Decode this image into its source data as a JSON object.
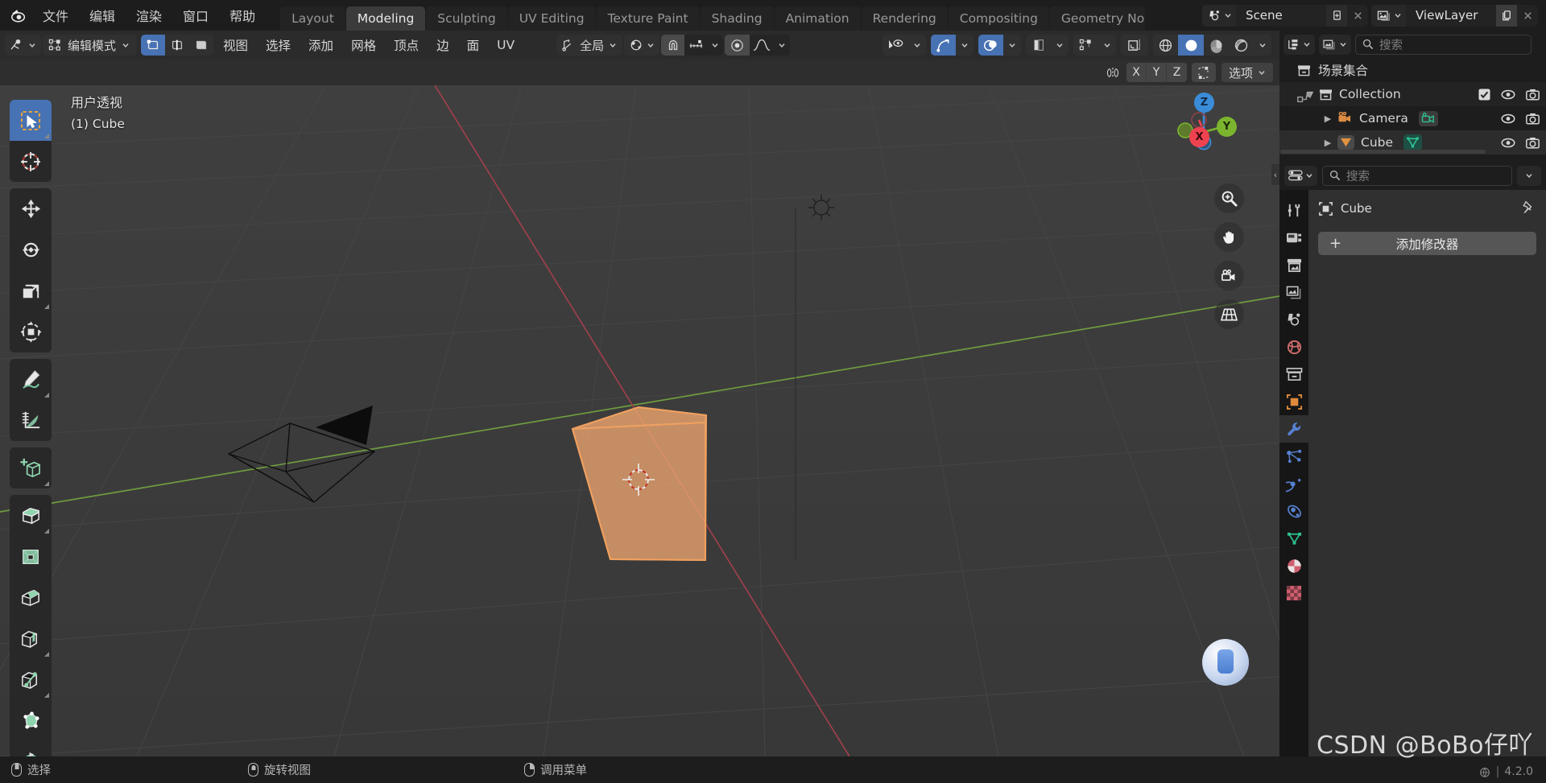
{
  "app": {
    "name": "Blender",
    "version": "4.2.0",
    "watermark": "CSDN @BoBo仔吖"
  },
  "topbar": {
    "logo_icon": "blender-logo-icon",
    "menus": [
      {
        "label": "文件",
        "name": "menu-file"
      },
      {
        "label": "编辑",
        "name": "menu-edit"
      },
      {
        "label": "渲染",
        "name": "menu-render"
      },
      {
        "label": "窗口",
        "name": "menu-window"
      },
      {
        "label": "帮助",
        "name": "menu-help"
      }
    ],
    "workspace_tabs": [
      {
        "label": "Layout",
        "active": false
      },
      {
        "label": "Modeling",
        "active": true
      },
      {
        "label": "Sculpting",
        "active": false
      },
      {
        "label": "UV Editing",
        "active": false
      },
      {
        "label": "Texture Paint",
        "active": false
      },
      {
        "label": "Shading",
        "active": false
      },
      {
        "label": "Animation",
        "active": false
      },
      {
        "label": "Rendering",
        "active": false
      },
      {
        "label": "Compositing",
        "active": false
      },
      {
        "label": "Geometry No",
        "active": false
      }
    ],
    "scene": {
      "browse_icon": "scene-browse-icon",
      "value": "Scene",
      "new_icon": "new-scene-icon",
      "delete_icon": "close-icon"
    },
    "view_layer": {
      "browse_icon": "viewlayer-browse-icon",
      "value": "ViewLayer",
      "new_icon": "copy-icon",
      "delete_icon": "close-icon"
    }
  },
  "viewport_header": {
    "editor_type_icon": "editor-type-3dview-icon",
    "mode": "编辑模式",
    "select_modes": [
      {
        "name": "vertex-select-mode",
        "active": true
      },
      {
        "name": "edge-select-mode",
        "active": false
      },
      {
        "name": "face-select-mode",
        "active": false
      }
    ],
    "menus": [
      {
        "label": "视图",
        "name": "menu-view"
      },
      {
        "label": "选择",
        "name": "menu-select"
      },
      {
        "label": "添加",
        "name": "menu-add"
      },
      {
        "label": "网格",
        "name": "menu-mesh"
      },
      {
        "label": "顶点",
        "name": "menu-vertex"
      },
      {
        "label": "边",
        "name": "menu-edge"
      },
      {
        "label": "面",
        "name": "menu-face"
      },
      {
        "label": "UV",
        "name": "menu-uv"
      }
    ],
    "transform_orientation": "全局",
    "snap_enabled": true,
    "proportional_edit_enabled": true,
    "shading_modes": [
      {
        "name": "wireframe-shading",
        "active": false
      },
      {
        "name": "solid-shading",
        "active": true
      },
      {
        "name": "material-preview-shading",
        "active": false
      },
      {
        "name": "rendered-shading",
        "active": false
      }
    ]
  },
  "viewport_subheader": {
    "mirror_icon": "mirror-icon",
    "axes": [
      "X",
      "Y",
      "Z"
    ],
    "topology_mirror_icon": "topology-mirror-icon",
    "options_label": "选项"
  },
  "viewport": {
    "view_name": "用户透视",
    "object_info": "(1) Cube",
    "gizmo": {
      "axes": [
        {
          "label": "Z",
          "color": "#3b8cd8"
        },
        {
          "label": "Y",
          "color": "#7bb52e"
        },
        {
          "label": "X",
          "color": "#ef4250"
        }
      ]
    },
    "nav_buttons": [
      {
        "name": "zoom-view-icon"
      },
      {
        "name": "pan-view-icon"
      },
      {
        "name": "camera-view-icon"
      },
      {
        "name": "toggle-perspective-icon"
      }
    ],
    "tools": [
      {
        "name": "tool-tweak-select-box",
        "active": true,
        "icon": "select-box-icon"
      },
      {
        "name": "tool-cursor",
        "active": false,
        "icon": "cursor-3d-icon"
      },
      {
        "name": "tool-move",
        "active": false,
        "icon": "move-icon"
      },
      {
        "name": "tool-rotate",
        "active": false,
        "icon": "rotate-icon"
      },
      {
        "name": "tool-scale",
        "active": false,
        "icon": "scale-icon"
      },
      {
        "name": "tool-transform",
        "active": false,
        "icon": "transform-icon"
      },
      {
        "name": "tool-annotate",
        "active": false,
        "icon": "annotate-icon"
      },
      {
        "name": "tool-measure",
        "active": false,
        "icon": "measure-icon"
      },
      {
        "name": "tool-add-cube",
        "active": false,
        "icon": "add-cube-icon"
      },
      {
        "name": "tool-extrude-region",
        "active": false,
        "icon": "extrude-region-icon"
      },
      {
        "name": "tool-inset-faces",
        "active": false,
        "icon": "inset-faces-icon"
      },
      {
        "name": "tool-bevel",
        "active": false,
        "icon": "bevel-icon"
      },
      {
        "name": "tool-loop-cut",
        "active": false,
        "icon": "loop-cut-icon"
      },
      {
        "name": "tool-knife",
        "active": false,
        "icon": "knife-icon"
      },
      {
        "name": "tool-poly-build",
        "active": false,
        "icon": "poly-build-icon"
      },
      {
        "name": "tool-spin",
        "active": false,
        "icon": "spin-icon"
      }
    ]
  },
  "outliner": {
    "display_mode_icon": "outliner-display-mode-icon",
    "filter_icon": "outliner-filter-icon",
    "search_placeholder": "搜索",
    "rows": [
      {
        "label": "场景集合",
        "name": "outliner-scene-collection",
        "indent": 0,
        "icon": "collection-icon",
        "expand": "",
        "restrict": []
      },
      {
        "label": "Collection",
        "name": "outliner-collection",
        "indent": 1,
        "icon": "collection-icon",
        "expand": "▼",
        "restrict": [
          "checkbox-checked",
          "eye-icon",
          "camera-icon"
        ]
      },
      {
        "label": "Camera",
        "name": "outliner-object-camera",
        "indent": 2,
        "icon": "camera-data-icon",
        "expand": "▶",
        "restrict": [
          "eye-icon",
          "camera-icon"
        ]
      },
      {
        "label": "Cube",
        "name": "outliner-object-cube",
        "indent": 2,
        "icon": "mesh-object-icon",
        "expand": "▶",
        "restrict": [
          "eye-icon",
          "camera-icon"
        ]
      }
    ]
  },
  "properties": {
    "editor_icon": "properties-editor-icon",
    "search_placeholder": "搜索",
    "expand_icon": "chevron-down-icon",
    "tabs": [
      {
        "name": "tab-tool",
        "icon": "tool-icon",
        "active": false,
        "color": "#c8c8c8"
      },
      {
        "name": "tab-render",
        "icon": "render-camera-icon",
        "active": false,
        "color": "#c8c8c8"
      },
      {
        "name": "tab-output",
        "icon": "printer-icon",
        "active": false,
        "color": "#c8c8c8"
      },
      {
        "name": "tab-view-layer",
        "icon": "images-icon",
        "active": false,
        "color": "#c8c8c8"
      },
      {
        "name": "tab-scene",
        "icon": "scene-cone-icon",
        "active": false,
        "color": "#c8c8c8"
      },
      {
        "name": "tab-world",
        "icon": "world-globe-icon",
        "active": false,
        "color": "#cf6b6b"
      },
      {
        "name": "tab-collection",
        "icon": "collection-box-icon",
        "active": false,
        "color": "#c8c8c8"
      },
      {
        "name": "tab-object",
        "icon": "object-square-icon",
        "active": false,
        "color": "#e08a3c"
      },
      {
        "name": "tab-modifiers",
        "icon": "wrench-icon",
        "active": true,
        "color": "#5680d0"
      },
      {
        "name": "tab-particles",
        "icon": "particles-icon",
        "active": false,
        "color": "#5680d0"
      },
      {
        "name": "tab-physics",
        "icon": "physics-orbit-icon",
        "active": false,
        "color": "#5680d0"
      },
      {
        "name": "tab-constraints",
        "icon": "constraints-icon",
        "active": false,
        "color": "#5680d0"
      },
      {
        "name": "tab-object-data",
        "icon": "mesh-data-triangle-icon",
        "active": false,
        "color": "#2fbf8f"
      },
      {
        "name": "tab-material",
        "icon": "material-sphere-icon",
        "active": false,
        "color": "#cf5f6e"
      },
      {
        "name": "tab-texture",
        "icon": "texture-checker-icon",
        "active": false,
        "color": "#cf5f6e"
      }
    ],
    "breadcrumb": {
      "icon": "object-square-icon",
      "label": "Cube",
      "pin_icon": "pin-icon"
    },
    "add_modifier_label": "添加修改器",
    "add_modifier_plus": "+"
  },
  "statusbar": {
    "items": [
      {
        "label": "选择",
        "name": "status-select",
        "mouse": "left"
      },
      {
        "label": "旋转视图",
        "name": "status-rotate-view",
        "mouse": "middle"
      },
      {
        "label": "调用菜单",
        "name": "status-call-menu",
        "mouse": "right"
      }
    ],
    "version_label": "4.2.0",
    "scene_stats_icon": "blender-status-icon"
  },
  "colors": {
    "accent_blue": "#4772b3",
    "selection_orange": "#ed9e5c",
    "grid_bg": "#3a3a3a",
    "axis_x_red": "#9c3b45",
    "axis_y_green": "#6b9c3b",
    "panel_bg": "#303030",
    "editor_bg": "#1d1d1d"
  }
}
